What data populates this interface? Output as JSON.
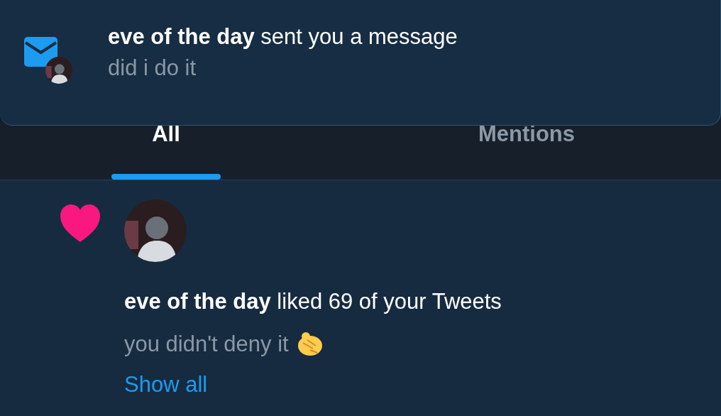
{
  "toast": {
    "kind": "message",
    "text": "**eve of the day** sent you a message",
    "preview": "did i do it"
  },
  "tabs": [
    {
      "label": "All",
      "selected": true
    },
    {
      "label": "Mentions",
      "selected": false
    }
  ],
  "notifications": [
    {
      "kind": "like",
      "text": "**eve of the day** liked 69 of your Tweets",
      "preview": "you didn't deny it",
      "link": "Show all"
    }
  ]
}
